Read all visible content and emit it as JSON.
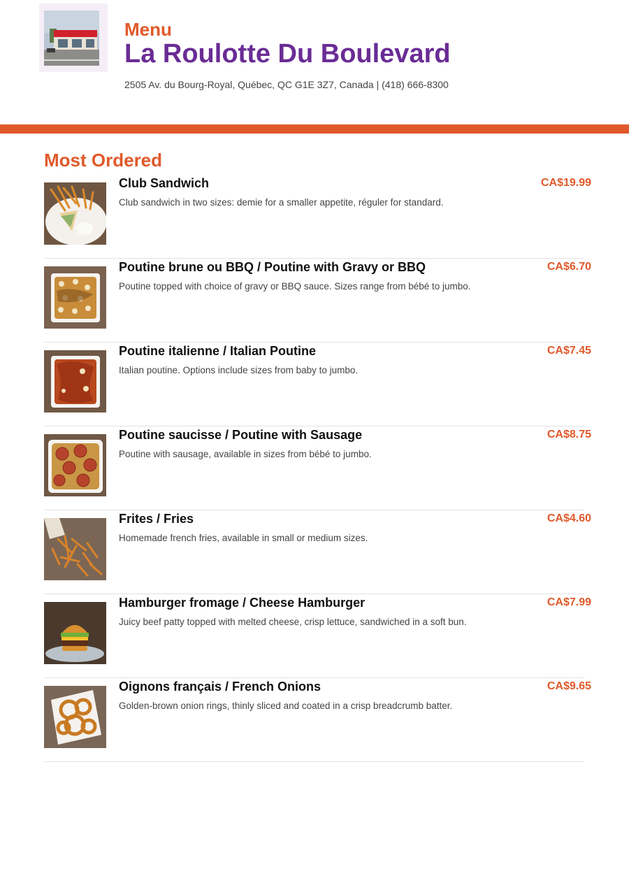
{
  "header": {
    "menu_label": "Menu",
    "restaurant_name": "La Roulotte Du Boulevard",
    "address_line": "2505 Av. du Bourg-Royal, Québec, QC G1E 3Z7, Canada | (418) 666-8300",
    "logo_icon": "restaurant-storefront-photo"
  },
  "colors": {
    "accent": "#e0592a",
    "brand_purple": "#6a2c95",
    "divider": "#e2e2e2"
  },
  "section": {
    "title": "Most Ordered",
    "items": [
      {
        "name": "Club Sandwich",
        "description": "Club sandwich in two sizes: demie for a smaller appetite, réguler for standard.",
        "price": "CA$19.99",
        "photo_icon": "club-sandwich-photo"
      },
      {
        "name": "Poutine brune ou BBQ / Poutine with Gravy or BBQ",
        "description": "Poutine topped with choice of gravy or BBQ sauce. Sizes range from bébé to jumbo.",
        "price": "CA$6.70",
        "photo_icon": "poutine-gravy-photo"
      },
      {
        "name": "Poutine italienne / Italian Poutine",
        "description": "Italian poutine. Options include sizes from baby to jumbo.",
        "price": "CA$7.45",
        "photo_icon": "italian-poutine-photo"
      },
      {
        "name": "Poutine saucisse / Poutine with Sausage",
        "description": "Poutine with sausage, available in sizes from bébé to jumbo.",
        "price": "CA$8.75",
        "photo_icon": "sausage-poutine-photo"
      },
      {
        "name": "Frites / Fries",
        "description": "Homemade french fries, available in small or medium sizes.",
        "price": "CA$4.60",
        "photo_icon": "fries-photo"
      },
      {
        "name": "Hamburger fromage / Cheese Hamburger",
        "description": "Juicy beef patty topped with melted cheese, crisp lettuce, sandwiched in a soft bun.",
        "price": "CA$7.99",
        "photo_icon": "cheeseburger-photo"
      },
      {
        "name": "Oignons français / French Onions",
        "description": "Golden-brown onion rings, thinly sliced and coated in a crisp breadcrumb batter.",
        "price": "CA$9.65",
        "photo_icon": "onion-rings-photo"
      }
    ]
  }
}
